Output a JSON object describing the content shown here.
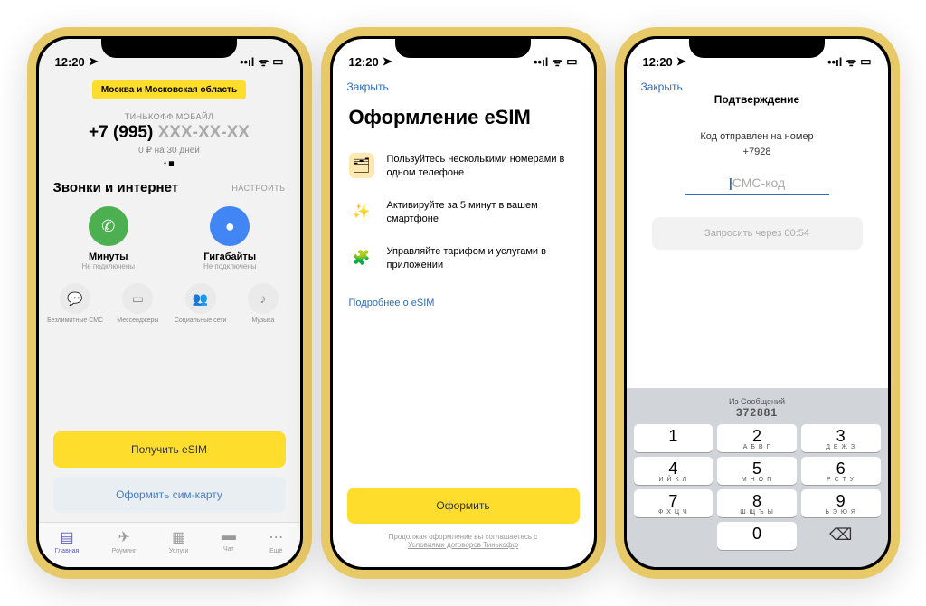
{
  "statusbar": {
    "time": "12:20"
  },
  "screen1": {
    "region": "Москва и Московская область",
    "brand": "ТИНЬКОФФ МОБАЙЛ",
    "phone_prefix": "+7 (995) ",
    "phone_mask": "XXX-XX-XX",
    "price": "0 ₽ на 30 дней",
    "section_title": "Звонки и интернет",
    "configure": "НАСТРОИТЬ",
    "minutes_label": "Минуты",
    "minutes_sub": "Не подключены",
    "gb_label": "Гигабайты",
    "gb_sub": "Не подключены",
    "options": [
      {
        "label": "Безлимитные СМС"
      },
      {
        "label": "Мессенджеры"
      },
      {
        "label": "Социальные сети"
      },
      {
        "label": "Музыка"
      }
    ],
    "btn_esim": "Получить eSIM",
    "btn_sim": "Оформить сим-карту",
    "tabs": [
      {
        "label": "Главная"
      },
      {
        "label": "Роуминг"
      },
      {
        "label": "Услуги"
      },
      {
        "label": "Чат"
      },
      {
        "label": "Ещё"
      }
    ]
  },
  "screen2": {
    "close": "Закрыть",
    "title": "Оформление eSIM",
    "feat1": "Пользуйтесь несколькими номерами в одном телефоне",
    "feat2": "Активируйте за 5 минут в вашем смартфоне",
    "feat3": "Управляйте тарифом и услугами в приложении",
    "learn_more": "Подробнее о eSIM",
    "submit": "Оформить",
    "agree_pre": "Продолжая оформление вы соглашаетесь с ",
    "agree_link": "Условиями договоров Тинькофф"
  },
  "screen3": {
    "close": "Закрыть",
    "nav_title": "Подтверждение",
    "sent_label": "Код отправлен на номер",
    "sent_number": "+7928",
    "placeholder": "СМС-код",
    "resend": "Запросить через 00:54",
    "autofill_title": "Из Сообщений",
    "autofill_code": "372881",
    "keys": [
      {
        "n": "1",
        "l": ""
      },
      {
        "n": "2",
        "l": "А Б В Г"
      },
      {
        "n": "3",
        "l": "Д Е Ж З"
      },
      {
        "n": "4",
        "l": "И Й К Л"
      },
      {
        "n": "5",
        "l": "М Н О П"
      },
      {
        "n": "6",
        "l": "Р С Т У"
      },
      {
        "n": "7",
        "l": "Ф Х Ц Ч"
      },
      {
        "n": "8",
        "l": "Ш Щ Ъ Ы"
      },
      {
        "n": "9",
        "l": "Ь Э Ю Я"
      },
      {
        "n": "0",
        "l": ""
      }
    ]
  }
}
